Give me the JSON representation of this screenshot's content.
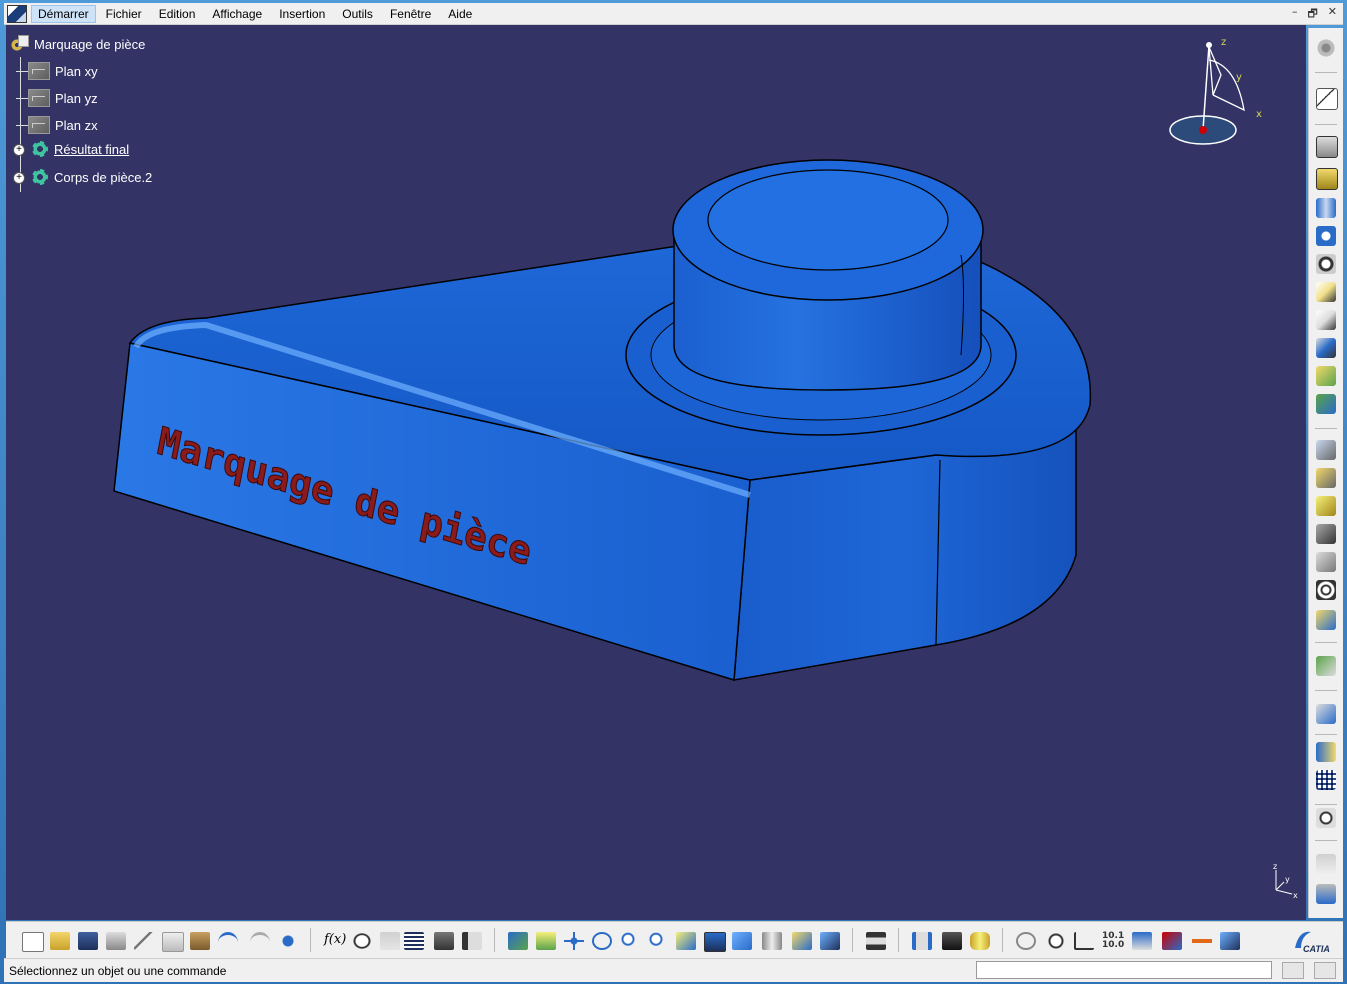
{
  "menu": {
    "items": [
      "Démarrer",
      "Fichier",
      "Edition",
      "Affichage",
      "Insertion",
      "Outils",
      "Fenêtre",
      "Aide"
    ],
    "window_controls": [
      "–",
      "🗗",
      "✕"
    ]
  },
  "tree": {
    "root": "Marquage de pièce",
    "items": [
      {
        "label": "Plan xy",
        "icon": "plane-icon"
      },
      {
        "label": "Plan yz",
        "icon": "plane-icon"
      },
      {
        "label": "Plan zx",
        "icon": "plane-icon"
      },
      {
        "label": "Résultat final",
        "icon": "part-body-icon",
        "expandable": true
      },
      {
        "label": "Corps de pièce.2",
        "icon": "part-body-icon",
        "expandable": true
      }
    ]
  },
  "compass": {
    "z": "z",
    "y": "y",
    "x": "x"
  },
  "model": {
    "engraved_text": "Marquage de pièce",
    "body_color": "#1560d8",
    "text_color": "#8b1a1a",
    "background_color": "#333366"
  },
  "axis_indicator": {
    "z": "z",
    "y": "y",
    "x": "x"
  },
  "status": {
    "message": "Sélectionnez un objet ou une commande",
    "command_input_value": ""
  },
  "brand": "CATIA"
}
